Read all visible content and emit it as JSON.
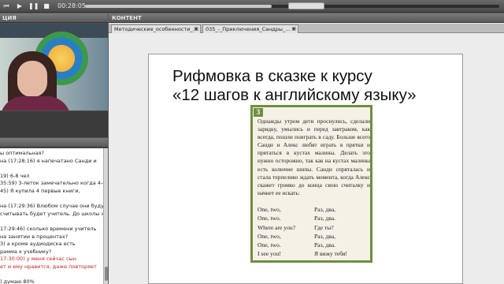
{
  "player": {
    "time": "00:28:05",
    "progress": 0.45,
    "buttons": [
      "skip-back",
      "play",
      "pause",
      "stop"
    ]
  },
  "left_panel": {
    "title": "ЦИЯ"
  },
  "chat": {
    "lines": [
      {
        "text": "ы оптимальная?",
        "color": "normal"
      },
      {
        "text": "на (17:28:16) я напечатано Санди и",
        "color": "normal"
      },
      {
        "text": "",
        "color": "normal"
      },
      {
        "text": "19) 6-8 чел",
        "color": "normal"
      },
      {
        "text": "35:59) 3-леток замечательно когда 4-6",
        "color": "normal"
      },
      {
        "text": "45) Я купила 4 первые книги,",
        "color": "normal"
      },
      {
        "text": "",
        "color": "normal"
      },
      {
        "text": "на (17:29:36) Влюбом случае они будут",
        "color": "normal"
      },
      {
        "text": "считывать будет учитель. До школы же",
        "color": "normal"
      },
      {
        "text": "",
        "color": "normal"
      },
      {
        "text": "17:29:46) сколько времени учитель",
        "color": "normal"
      },
      {
        "text": "на занятии в процентах?",
        "color": "normal"
      },
      {
        "text": "3) а кроме аудиодиска есть",
        "color": "normal"
      },
      {
        "text": "рамма к учебнику?",
        "color": "normal"
      },
      {
        "text": "17:30:00) у меня сейчас сын",
        "color": "red"
      },
      {
        "text": "ет и ему нравится, даже повторяет",
        "color": "red"
      },
      {
        "text": "",
        "color": "normal"
      },
      {
        "text": ") думаю 80%",
        "color": "normal"
      }
    ]
  },
  "content": {
    "title": "КОНТЕНТ",
    "tabs": [
      {
        "label": "Методические_особенности_..."
      },
      {
        "label": "035_-_Приключения_Сандры_..."
      }
    ]
  },
  "slide": {
    "title_line1": "Рифмовка в сказке к курсу",
    "title_line2": "«12 шагов к английскому языку»",
    "book": {
      "number": "3",
      "paragraph": "Однажды утром дети проснулись, сделали зарядку, умылись и перед завтраком, как всегда, пошли поиграть в саду. Больше всего Санди и Алекс любят играть в прятки и прятаться в кустах малины. Делать это нужно осторожно, так как на кустах малины есть колючие шипы. Санди спряталась и стала терпеливо ждать момента, когда Алекс скажет громко до конца свою считалку и начнет ее искать:",
      "verse": [
        {
          "en": "One, two,",
          "ru": "Раз, два,"
        },
        {
          "en": "One, two.",
          "ru": "Раз, два."
        },
        {
          "en": "Where are you?",
          "ru": "Где ты?"
        },
        {
          "en": "One, two,",
          "ru": "Раз, два,"
        },
        {
          "en": "One, two.",
          "ru": "Раз, два."
        },
        {
          "en": "I see you!",
          "ru": "Я вижу тебя!"
        }
      ]
    }
  }
}
